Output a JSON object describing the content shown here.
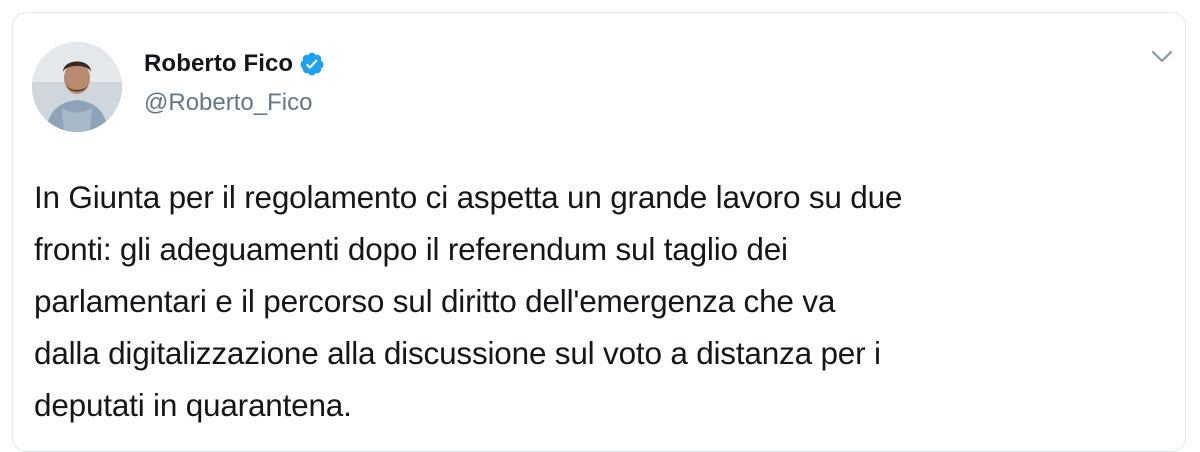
{
  "author": {
    "name": "Roberto Fico",
    "handle": "@Roberto_Fico",
    "verified": true
  },
  "tweet": {
    "lines": [
      "In Giunta per il regolamento ci aspetta un grande lavoro su due",
      "fronti: gli adeguamenti dopo il referendum sul taglio dei",
      "parlamentari e il percorso sul diritto dell'emergenza che va",
      "dalla digitalizzazione alla discussione sul voto a distanza per i",
      "deputati in quarantena."
    ]
  },
  "icons": {
    "verified": "verified-badge-icon",
    "menu": "chevron-down-icon"
  },
  "colors": {
    "verified_blue": "#1da1f2",
    "text": "#14171a",
    "secondary": "#657786",
    "border": "#e1e8ed"
  }
}
